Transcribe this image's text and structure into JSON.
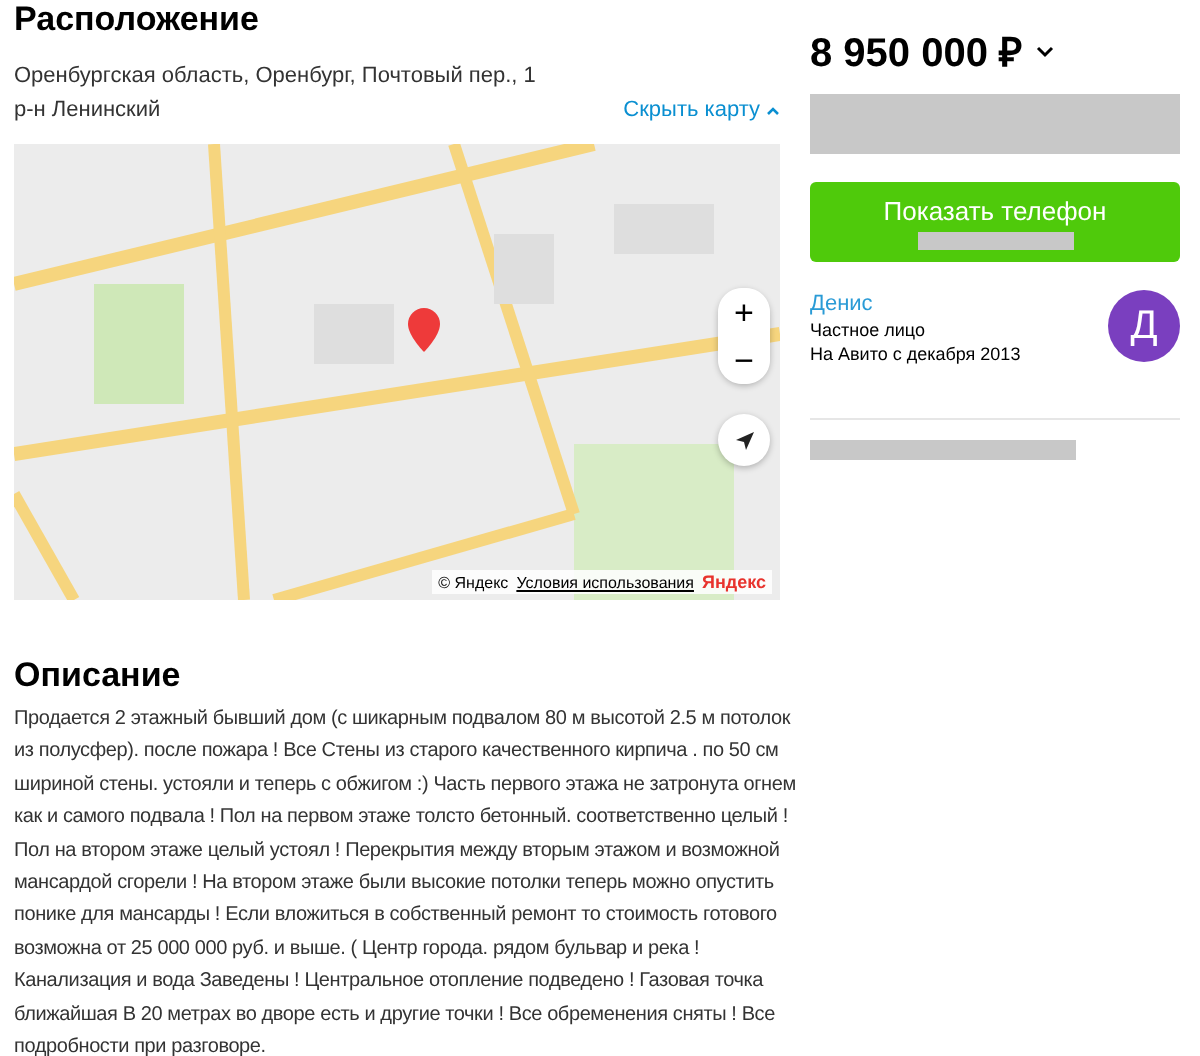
{
  "location": {
    "title": "Расположение",
    "address": "Оренбургская область, Оренбург, Почтовый пер., 1",
    "district": "р-н Ленинский",
    "toggle": "Скрыть карту",
    "map": {
      "kind": "picture",
      "zoom_in": "+",
      "zoom_out": "−",
      "copyright": "© Яндекс",
      "terms": "Условия использования",
      "brand": "Яндекс"
    }
  },
  "description": {
    "title": "Описание",
    "text": "Продается 2 этажный бывший дом (с шикарным подвалом 80 м высотой 2.5 м потолок из полусфер). после пожара ! Все Стены из старого качественного кирпича . по 50 см шириной стены. устояли и теперь с обжигом :) Часть первого этажа не затронута огнем как и самого подвала ! Пол на первом этаже толсто бетонный. соответственно целый ! Пол на втором этаже целый устоял ! Перекрытия между вторым этажом и возможной мансардой сгорели ! На втором этаже были высокие потолки теперь можно опустить понике для мансарды ! Если вложиться в собственный ремонт то стоимость готового возможна от 25 000 000 руб. и выше. ( Центр города. рядом бульвар и река ! Канализация и вода Заведены ! Центральное отопление подведено ! Газовая точка ближайшая В 20 метрах во дворе есть и другие точки ! Все обременения сняты ! Все подробности при разговоре."
  },
  "sidebar": {
    "price": "8 950 000 ₽",
    "phone_button": "Показать телефон",
    "seller": {
      "name": "Денис",
      "type": "Частное лицо",
      "since": "На Авито с декабря 2013",
      "avatar_letter": "Д"
    }
  }
}
